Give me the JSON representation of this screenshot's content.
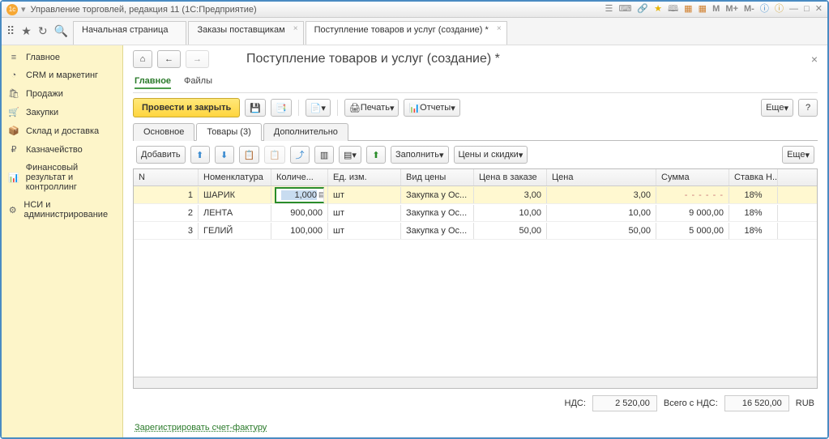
{
  "window": {
    "title": "Управление торговлей, редакция 11  (1С:Предприятие)"
  },
  "top_tabs": [
    {
      "label": "Начальная страница"
    },
    {
      "label": "Заказы поставщикам"
    },
    {
      "label": "Поступление товаров и услуг (создание) *"
    }
  ],
  "sidebar": [
    {
      "icon": "≡",
      "label": "Главное"
    },
    {
      "icon": "◔",
      "label": "CRM и маркетинг"
    },
    {
      "icon": "🛍",
      "label": "Продажи"
    },
    {
      "icon": "🛒",
      "label": "Закупки"
    },
    {
      "icon": "📦",
      "label": "Склад и доставка"
    },
    {
      "icon": "₽",
      "label": "Казначейство"
    },
    {
      "icon": "📊",
      "label": "Финансовый результат и контроллинг"
    },
    {
      "icon": "⚙",
      "label": "НСИ и администрирование"
    }
  ],
  "doc": {
    "title": "Поступление товаров и услуг (создание) *",
    "subtabs": {
      "main": "Главное",
      "files": "Файлы"
    },
    "cmd": {
      "post_close": "Провести и закрыть",
      "print": "Печать",
      "reports": "Отчеты",
      "more": "Еще",
      "help": "?"
    },
    "inner_tabs": {
      "basic": "Основное",
      "goods": "Товары (3)",
      "extra": "Дополнительно"
    },
    "grid_cmd": {
      "add": "Добавить",
      "fill": "Заполнить",
      "prices": "Цены и скидки",
      "more": "Еще"
    },
    "columns": {
      "n": "N",
      "nom": "Номенклатура",
      "qty": "Количе...",
      "ed": "Ед. изм.",
      "vid": "Вид цены",
      "czk": "Цена в заказе",
      "cena": "Цена",
      "sum": "Сумма",
      "vat": "Ставка Н..."
    },
    "rows": [
      {
        "n": "1",
        "nom": "ШАРИК",
        "qty": "1,000",
        "ed": "шт",
        "vid": "Закупка у Ос...",
        "czk": "3,00",
        "cena": "3,00",
        "sum": "",
        "vat": "18%"
      },
      {
        "n": "2",
        "nom": "ЛЕНТА",
        "qty": "900,000",
        "ed": "шт",
        "vid": "Закупка у Ос...",
        "czk": "10,00",
        "cena": "10,00",
        "sum": "9 000,00",
        "vat": "18%"
      },
      {
        "n": "3",
        "nom": "ГЕЛИЙ",
        "qty": "100,000",
        "ed": "шт",
        "vid": "Закупка у Ос...",
        "czk": "50,00",
        "cena": "50,00",
        "sum": "5 000,00",
        "vat": "18%"
      }
    ],
    "footer": {
      "nds_label": "НДС:",
      "nds": "2 520,00",
      "total_label": "Всего с НДС:",
      "total": "16 520,00",
      "cur": "RUB"
    },
    "reg_link": "Зарегистрировать счет-фактуру"
  }
}
